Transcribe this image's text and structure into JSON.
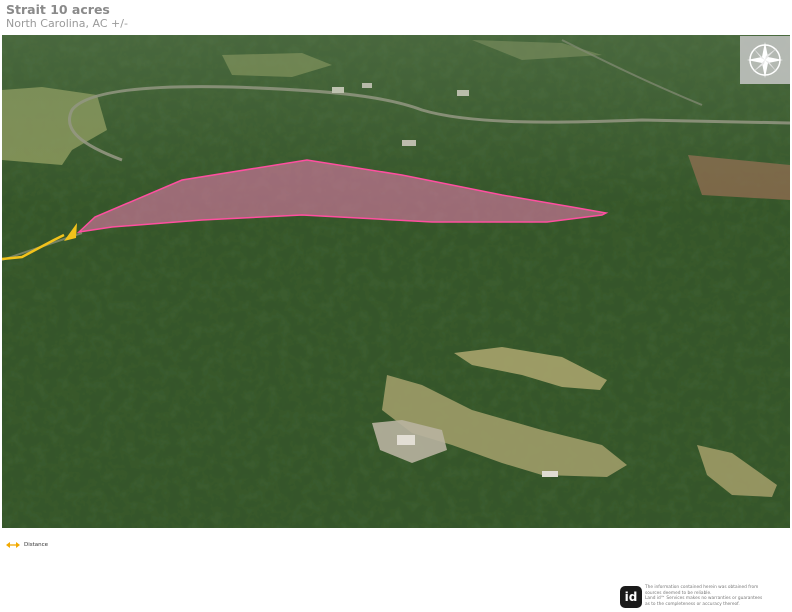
{
  "header": {
    "title": "Strait 10 acres",
    "subtitle": "North Carolina,  AC +/-"
  },
  "map": {
    "type": "satellite-3d-view",
    "parcel_outline_color": "#ff4fa0",
    "parcel_fill_color": "#e07aa8",
    "distance_marker_color": "#f2c21b",
    "forest_color": "#2b4a22",
    "field_color": "#a8a26a"
  },
  "compass": {
    "icon": "compass-rose-icon"
  },
  "legend": {
    "items": [
      {
        "label": "Distance",
        "icon": "double-arrow-icon",
        "color": "#f2a900"
      }
    ]
  },
  "footer": {
    "logo_text": "id",
    "disclaimer_line1": "The information contained herein was obtained from",
    "disclaimer_line2": "sources deemed to be reliable.",
    "disclaimer_line3": "Land id™ Services makes no warranties or guarantees",
    "disclaimer_line4": "as to the completeness or accuracy thereof."
  }
}
